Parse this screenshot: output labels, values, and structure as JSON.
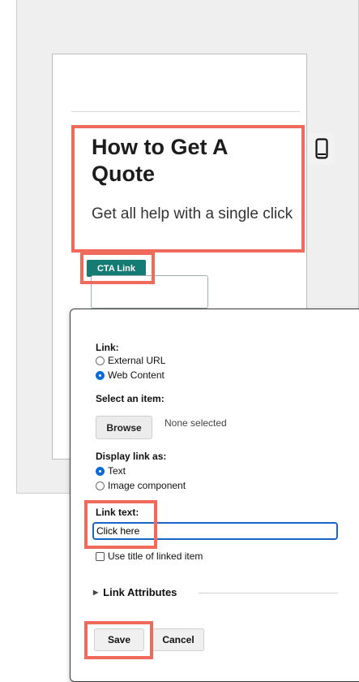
{
  "preview": {
    "headline": "How to Get A Quote",
    "subtitle": "Get all help with a single click",
    "cta_label": "CTA Link",
    "mobile_icon": "mobile-device-icon"
  },
  "dialog": {
    "link_label": "Link:",
    "link_options": [
      "External URL",
      "Web Content"
    ],
    "link_selected": "Web Content",
    "select_item_label": "Select an item:",
    "browse_label": "Browse",
    "selection_status": "None selected",
    "display_as_label": "Display link as:",
    "display_options": [
      "Text",
      "Image component"
    ],
    "display_selected": "Text",
    "link_text_label": "Link text:",
    "link_text_value": "Click here",
    "use_title_label": "Use title of linked item",
    "link_attributes_label": "Link Attributes",
    "save_label": "Save",
    "cancel_label": "Cancel"
  },
  "colors": {
    "highlight": "#ef6a5a",
    "cta_background": "#157c74",
    "focus_blue": "#1a64c8"
  }
}
